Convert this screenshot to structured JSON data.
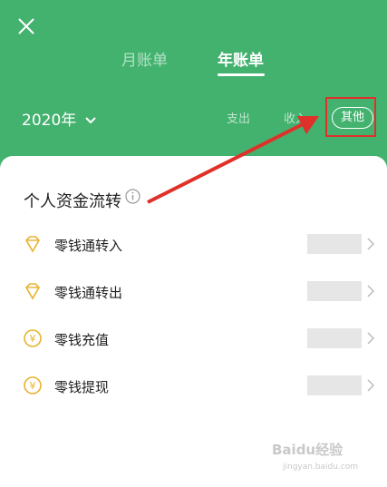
{
  "header": {
    "tabs": [
      {
        "label": "月账单",
        "active": false
      },
      {
        "label": "年账单",
        "active": true
      }
    ],
    "year": "2020年",
    "filters": {
      "expense": "支出",
      "income": "收入",
      "other": "其他"
    },
    "accent_color": "#43b26f"
  },
  "section": {
    "title": "个人资金流转"
  },
  "rows": [
    {
      "label": "零钱通转入",
      "icon": "diamond-icon"
    },
    {
      "label": "零钱通转出",
      "icon": "diamond-icon"
    },
    {
      "label": "零钱充值",
      "icon": "yuan-coin-icon"
    },
    {
      "label": "零钱提现",
      "icon": "yuan-coin-icon"
    }
  ],
  "watermark": {
    "text": "Baidu经验",
    "sub": "jingyan.baidu.com"
  }
}
